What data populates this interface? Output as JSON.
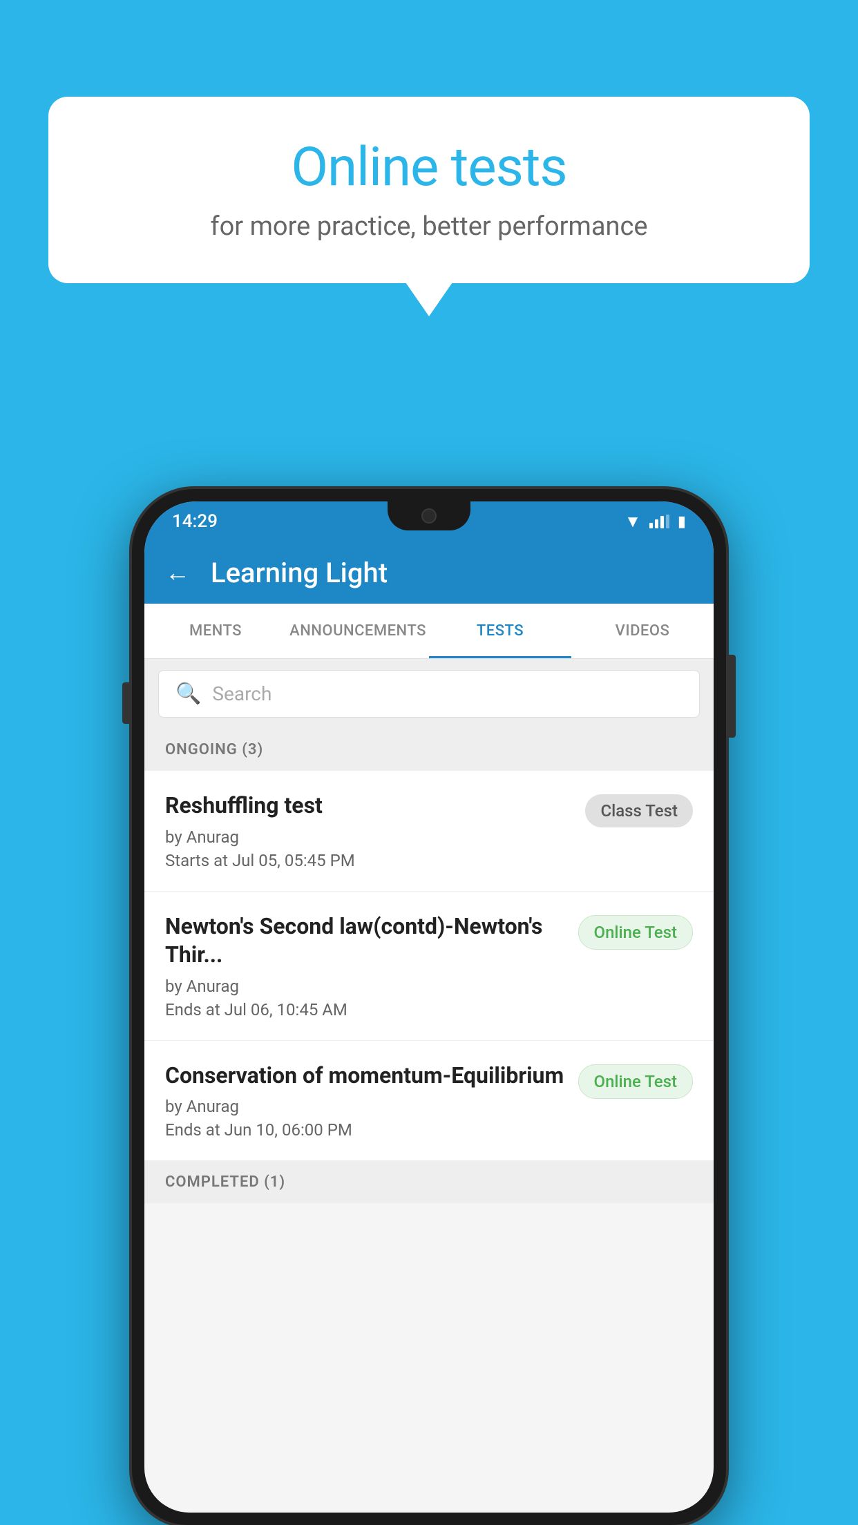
{
  "background_color": "#2BB5E8",
  "promo": {
    "title": "Online tests",
    "subtitle": "for more practice, better performance"
  },
  "phone": {
    "status_bar": {
      "time": "14:29"
    },
    "app_bar": {
      "title": "Learning Light",
      "back_label": "←"
    },
    "tabs": [
      {
        "label": "MENTS",
        "active": false
      },
      {
        "label": "ANNOUNCEMENTS",
        "active": false
      },
      {
        "label": "TESTS",
        "active": true
      },
      {
        "label": "VIDEOS",
        "active": false
      }
    ],
    "search": {
      "placeholder": "Search"
    },
    "ongoing_section": {
      "label": "ONGOING (3)"
    },
    "tests": [
      {
        "name": "Reshuffling test",
        "by": "by Anurag",
        "date_label": "Starts at",
        "date": "Jul 05, 05:45 PM",
        "badge": "Class Test",
        "badge_type": "class"
      },
      {
        "name": "Newton's Second law(contd)-Newton's Thir...",
        "by": "by Anurag",
        "date_label": "Ends at",
        "date": "Jul 06, 10:45 AM",
        "badge": "Online Test",
        "badge_type": "online"
      },
      {
        "name": "Conservation of momentum-Equilibrium",
        "by": "by Anurag",
        "date_label": "Ends at",
        "date": "Jun 10, 06:00 PM",
        "badge": "Online Test",
        "badge_type": "online"
      }
    ],
    "completed_section": {
      "label": "COMPLETED (1)"
    }
  }
}
